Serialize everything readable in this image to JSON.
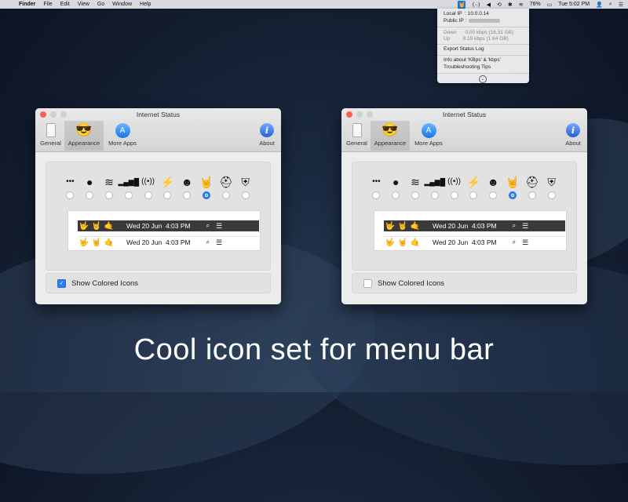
{
  "menubar": {
    "apple": "",
    "items": [
      "Finder",
      "File",
      "Edit",
      "View",
      "Go",
      "Window",
      "Help"
    ],
    "status": {
      "app_icon": "🤘",
      "arrows": "⟨··⟩",
      "volume": "◀",
      "time_machine": "⟲",
      "bluetooth": "✱",
      "wifi": "≋",
      "battery": "76%",
      "battery_glyph": "▭",
      "datetime": "Tue 5:02 PM",
      "user": "👤",
      "search": "⌕",
      "menu": "☰"
    }
  },
  "dropdown": {
    "local_ip_label": "Local IP",
    "local_ip_value": ": 10.0.0.14",
    "public_ip_label": "Public IP",
    "public_ip_value": ":",
    "down_label": "Down",
    "down_value": "0.00 kbps (16.31 GB)",
    "up_label": "Up",
    "up_value": "8.19 kbps (1.64 GB)",
    "export": "Export Status Log",
    "info": "Info about 'KBps' & 'kbps'",
    "tips": "Troubleshooting Tips",
    "chevron": "⌄"
  },
  "window_left": {
    "title": "Internet Status",
    "toolbar": {
      "general": "General",
      "appearance": "Appearance",
      "more_apps": "More Apps",
      "about": "About"
    },
    "checkbox": {
      "label": "Show Colored Icons",
      "checked": true,
      "check": "✓"
    },
    "preview": {
      "dark_hands": [
        "🤟",
        "🤘",
        "🤙"
      ],
      "light_hands": [
        "🤟",
        "🤘",
        "🤙"
      ],
      "date": "Wed 20 Jun",
      "time": "4:03 PM"
    }
  },
  "window_right": {
    "title": "Internet Status",
    "toolbar": {
      "general": "General",
      "appearance": "Appearance",
      "more_apps": "More Apps",
      "about": "About"
    },
    "checkbox": {
      "label": "Show Colored Icons",
      "checked": false,
      "check": ""
    },
    "preview": {
      "dark_hands": [
        "🤟",
        "🤘",
        "🤙"
      ],
      "light_hands": [
        "🤟",
        "🤘",
        "🤙"
      ],
      "date": "Wed 20 Jun",
      "time": "4:03 PM"
    }
  },
  "toolbar_icons": {
    "general": "▯",
    "appearance": "😎",
    "more_apps": "A",
    "about": "i"
  },
  "icon_set": [
    "•••",
    "●",
    "wifi",
    "bars",
    "((•))",
    "plug",
    "☻",
    "🤘",
    "mask",
    "helmet"
  ],
  "icon_glyphs": [
    "•••",
    "●",
    "≋",
    "▂▄▆█",
    "((•))",
    "⚡",
    "☻",
    "🤘",
    "⛑",
    "⛨"
  ],
  "selected_icon_index": 7,
  "preview_icons": {
    "search": "⌕",
    "list": "☰"
  },
  "caption": "Cool icon set for menu bar",
  "colors": {
    "accent": "#2a7ff0",
    "close": "#fc5f57",
    "hand_red": "#e64b4b",
    "hand_orange": "#f5a623",
    "hand_green": "#3fb74a"
  }
}
